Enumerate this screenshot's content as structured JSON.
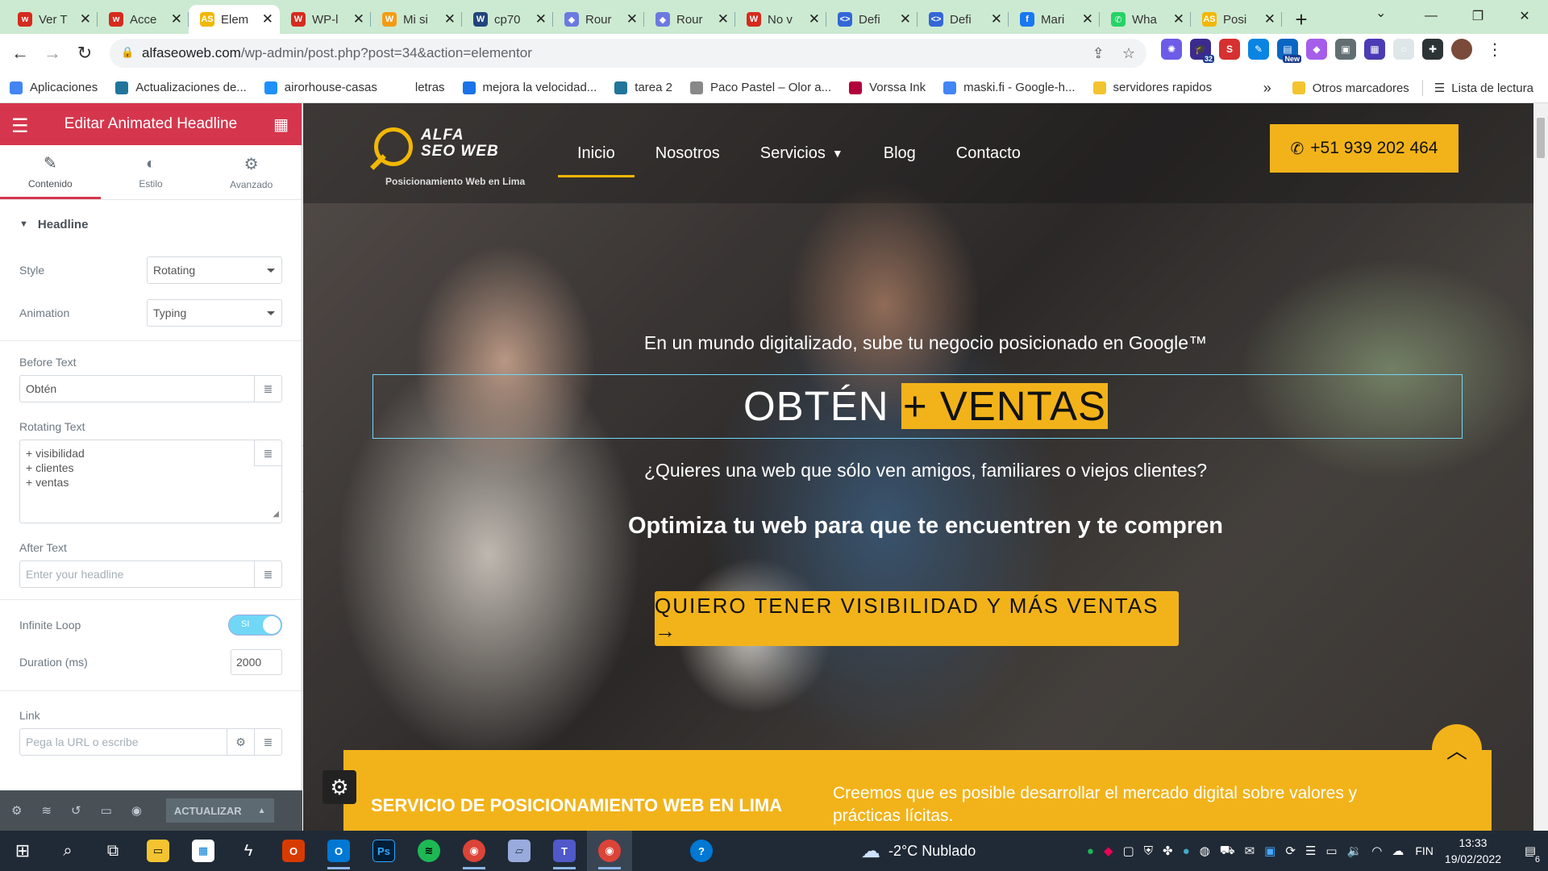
{
  "browser": {
    "tabs": [
      {
        "title": "Ver T",
        "favicon": "w",
        "color": "#d52b1e",
        "active": false
      },
      {
        "title": "Acce",
        "favicon": "w",
        "color": "#d52b1e",
        "active": false
      },
      {
        "title": "Elem",
        "favicon": "AS",
        "color": "#f2b705",
        "active": true
      },
      {
        "title": "WP-l",
        "favicon": "W",
        "color": "#d52b1e",
        "active": false
      },
      {
        "title": "Mi si",
        "favicon": "W",
        "color": "#f39c12",
        "active": false
      },
      {
        "title": "cp70",
        "favicon": "W",
        "color": "#21457b",
        "active": false
      },
      {
        "title": "Rour",
        "favicon": "◆",
        "color": "#6c7ae0",
        "active": false
      },
      {
        "title": "Rour",
        "favicon": "◆",
        "color": "#6c7ae0",
        "active": false
      },
      {
        "title": "No v",
        "favicon": "W",
        "color": "#d52b1e",
        "active": false
      },
      {
        "title": "Defi",
        "favicon": "<>",
        "color": "#3367d6",
        "active": false
      },
      {
        "title": "Defi",
        "favicon": "<>",
        "color": "#3367d6",
        "active": false
      },
      {
        "title": "Mari",
        "favicon": "f",
        "color": "#1877f2",
        "active": false
      },
      {
        "title": "Wha",
        "favicon": "✆",
        "color": "#25d366",
        "active": false
      },
      {
        "title": "Posi",
        "favicon": "AS",
        "color": "#f2b705",
        "active": false
      }
    ],
    "new_tab": "+",
    "url_host": "alfaseoweb.com",
    "url_path": "/wp-admin/post.php?post=34&action=elementor",
    "extensions": [
      {
        "label": "✺",
        "color": "#6c5ce7",
        "badge": ""
      },
      {
        "label": "🎓",
        "color": "#3b2a8f",
        "badge": "32"
      },
      {
        "label": "S",
        "color": "#d63031",
        "badge": ""
      },
      {
        "label": "✎",
        "color": "#0984e3",
        "badge": ""
      },
      {
        "label": "▤",
        "color": "#0a66c2",
        "badge": "New"
      },
      {
        "label": "◆",
        "color": "#a55eea",
        "badge": ""
      },
      {
        "label": "▣",
        "color": "#636e72",
        "badge": ""
      },
      {
        "label": "▦",
        "color": "#4b3bb5",
        "badge": ""
      },
      {
        "label": "○",
        "color": "#dfe6e9",
        "badge": ""
      },
      {
        "label": "✚",
        "color": "#2d3436",
        "badge": ""
      }
    ],
    "bookmarks": [
      {
        "label": "Aplicaciones",
        "color": "#4285f4"
      },
      {
        "label": "Actualizaciones de...",
        "color": "#21759b"
      },
      {
        "label": "airorhouse-casas",
        "color": "#1e90ff"
      },
      {
        "label": "letras",
        "color": "#ffffff"
      },
      {
        "label": "mejora la velocidad...",
        "color": "#1a73e8"
      },
      {
        "label": "tarea 2",
        "color": "#21759b"
      },
      {
        "label": "Paco Pastel – Olor a...",
        "color": "#888888"
      },
      {
        "label": "Vorssa Ink",
        "color": "#b3003c"
      },
      {
        "label": "maski.fi - Google-h...",
        "color": "#4285f4"
      },
      {
        "label": "servidores rapidos",
        "color": "#f4c430"
      }
    ],
    "bookmarks_more": "»",
    "other_bookmarks": "Otros marcadores",
    "reading_list": "Lista de lectura"
  },
  "panel": {
    "title": "Editar Animated Headline",
    "tabs": [
      {
        "label": "Contenido",
        "icon": "✎"
      },
      {
        "label": "Estilo",
        "icon": "◐"
      },
      {
        "label": "Avanzado",
        "icon": "⚙"
      }
    ],
    "section": "Headline",
    "style_label": "Style",
    "style_value": "Rotating",
    "animation_label": "Animation",
    "animation_value": "Typing",
    "before_label": "Before Text",
    "before_value": "Obtén",
    "rotating_label": "Rotating Text",
    "rotating_lines": [
      "+ visibilidad",
      "+ clientes",
      "+ ventas"
    ],
    "after_label": "After Text",
    "after_placeholder": "Enter your headline",
    "loop_label": "Infinite Loop",
    "loop_value": "SI",
    "duration_label": "Duration (ms)",
    "duration_value": "2000",
    "link_label": "Link",
    "link_placeholder": "Pega la URL o escribe",
    "update_label": "ACTUALIZAR"
  },
  "site": {
    "brand_line1": "ALFA",
    "brand_line2": "SEO WEB",
    "tagline": "Posicionamiento Web en Lima",
    "nav": [
      "Inicio",
      "Nosotros",
      "Servicios",
      "Blog",
      "Contacto"
    ],
    "phone": "+51 939 202 464",
    "subtitle": "En un mundo digitalizado, sube tu negocio posicionado en Google™",
    "headline_before": "OBTÉN",
    "headline_rotating": "+ VENTAS",
    "question": "¿Quieres una web que sólo ven amigos, familiares o viejos clientes?",
    "optimize": "Optimiza tu web para que te encuentren y te compren",
    "cta": "QUIERO TENER VISIBILIDAD Y MÁS VENTAS →",
    "band_left": "SERVICIO DE POSICIONAMIENTO WEB EN LIMA",
    "band_right": "Creemos que es posible desarrollar el mercado digital sobre valores y prácticas lícitas.",
    "accent": "#f2b31a"
  },
  "taskbar": {
    "weather_temp": "-2°C",
    "weather_desc": "Nublado",
    "lang": "FIN",
    "time": "13:33",
    "date": "19/02/2022",
    "notifications": "6"
  }
}
